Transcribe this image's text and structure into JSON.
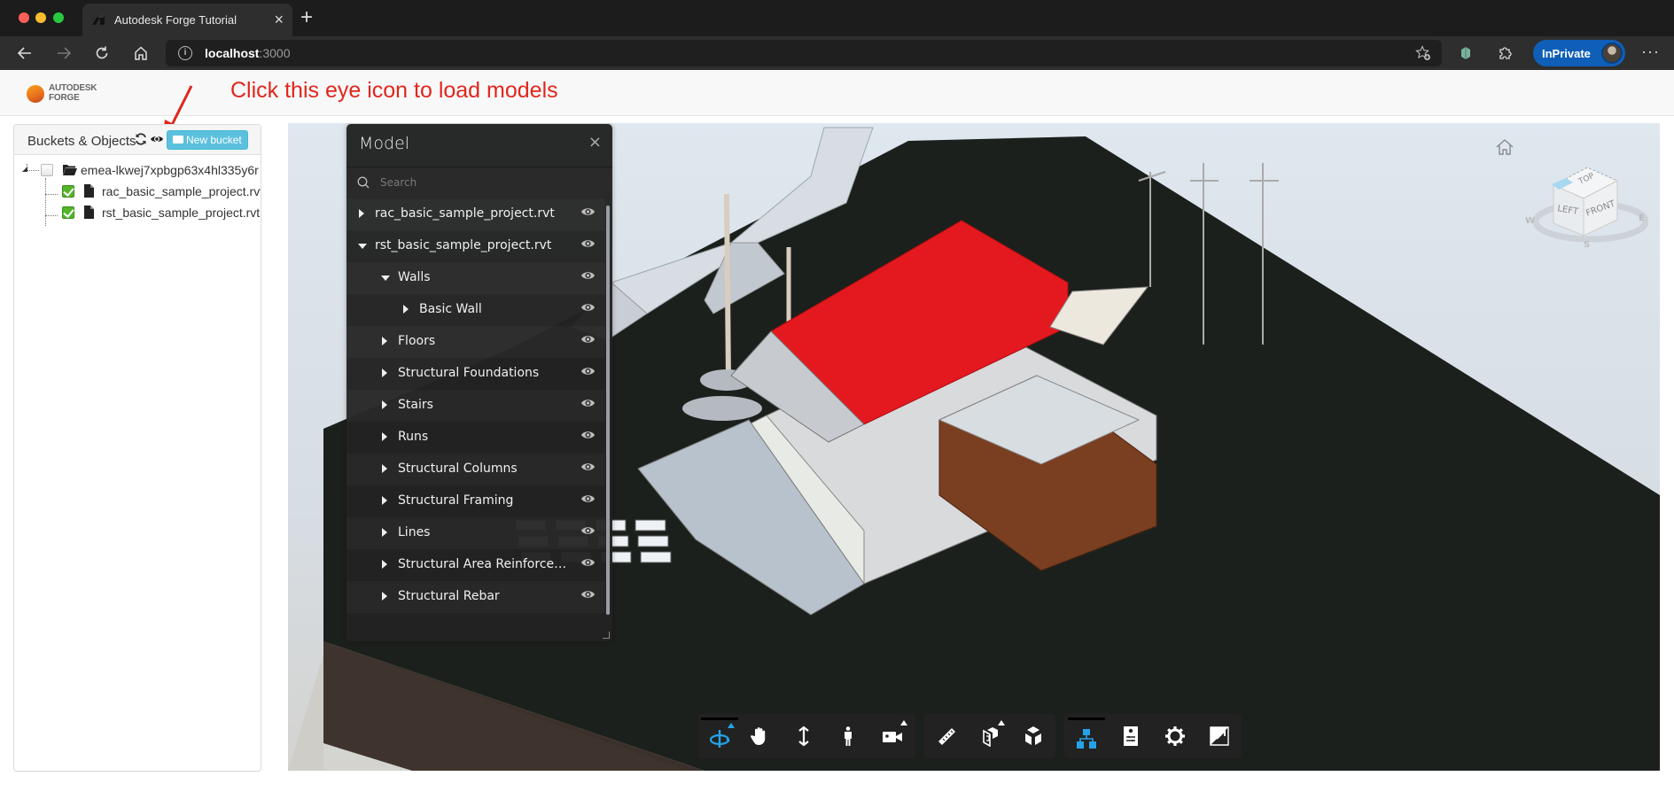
{
  "browser": {
    "tab_title": "Autodesk Forge Tutorial",
    "tab_close": "×",
    "new_tab": "+",
    "url_host": "localhost",
    "url_port": ":3000",
    "profile_label": "InPrivate",
    "more_label": "···",
    "nav_icons": [
      "back-icon",
      "forward-icon",
      "refresh-icon",
      "home-icon"
    ],
    "extension_icons": [
      "favorites-add-icon",
      "extension-icon",
      "puzzle-icon"
    ]
  },
  "app": {
    "logo_line1": "AUTODESK",
    "logo_line2": "FORGE",
    "annotation": "Click this eye icon to load models",
    "annotation_color": "#e0261c"
  },
  "buckets_panel": {
    "title": "Buckets & Objects",
    "new_bucket_label": "New bucket",
    "accent_color": "#5bc0de",
    "tree": {
      "bucket": {
        "name": "emea-lkwej7xpbgp63x4hl335y6r",
        "checked": false
      },
      "objects": [
        {
          "name": "rac_basic_sample_project.rvt",
          "checked": true
        },
        {
          "name": "rst_basic_sample_project.rvt",
          "checked": true
        }
      ]
    }
  },
  "model_browser": {
    "title": "Model",
    "close_label": "×",
    "search_placeholder": "Search",
    "items": [
      {
        "label": "rac_basic_sample_project.rvt",
        "level": 0,
        "expanded": false
      },
      {
        "label": "rst_basic_sample_project.rvt",
        "level": 0,
        "expanded": true
      },
      {
        "label": "Walls",
        "level": 1,
        "expanded": true
      },
      {
        "label": "Basic Wall",
        "level": 2,
        "expanded": false
      },
      {
        "label": "Floors",
        "level": 1,
        "expanded": false
      },
      {
        "label": "Structural Foundations",
        "level": 1,
        "expanded": false
      },
      {
        "label": "Stairs",
        "level": 1,
        "expanded": false
      },
      {
        "label": "Runs",
        "level": 1,
        "expanded": false
      },
      {
        "label": "Structural Columns",
        "level": 1,
        "expanded": false
      },
      {
        "label": "Structural Framing",
        "level": 1,
        "expanded": false
      },
      {
        "label": "Lines",
        "level": 1,
        "expanded": false
      },
      {
        "label": "Structural Area Reinforcement",
        "level": 1,
        "expanded": false
      },
      {
        "label": "Structural Rebar",
        "level": 1,
        "expanded": false
      }
    ]
  },
  "viewcube": {
    "faces": {
      "top": "TOP",
      "left": "LEFT",
      "front": "FRONT"
    },
    "compass": {
      "w": "W",
      "s": "S",
      "e": "E"
    }
  },
  "viewer_toolbar": {
    "active_color": "#26a2e8",
    "groups": [
      [
        "orbit-icon",
        "pan-icon",
        "zoom-icon",
        "first-person-icon",
        "camera-icon"
      ],
      [
        "measure-icon",
        "section-icon",
        "explode-icon"
      ],
      [
        "model-browser-icon",
        "properties-icon",
        "settings-icon",
        "fullscreen-icon"
      ]
    ]
  }
}
